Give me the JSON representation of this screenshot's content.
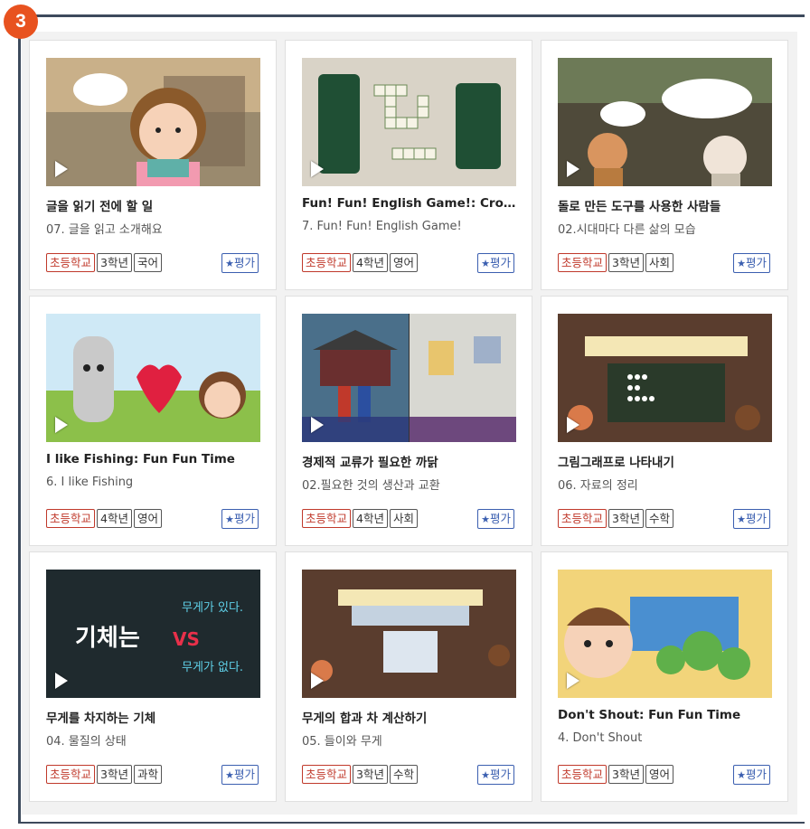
{
  "step_badge": "3",
  "rate_label": "평가",
  "cards": [
    {
      "title": "글을 읽기 전에 할 일",
      "subtitle": "07. 글을 읽고 소개해요",
      "tags": [
        "초등학교",
        "3학년",
        "국어"
      ],
      "theme": "reading"
    },
    {
      "title": "Fun! Fun! English Game!: Cros…",
      "subtitle": "7. Fun! Fun! English Game!",
      "tags": [
        "초등학교",
        "4학년",
        "영어"
      ],
      "theme": "crossword"
    },
    {
      "title": "돌로 만든 도구를 사용한 사람들",
      "subtitle": "02.시대마다 다른 삶의 모습",
      "tags": [
        "초등학교",
        "3학년",
        "사회"
      ],
      "theme": "stone"
    },
    {
      "title": "I like Fishing: Fun Fun Time",
      "subtitle": "6. I like Fishing",
      "tags": [
        "초등학교",
        "4학년",
        "영어"
      ],
      "theme": "fishing"
    },
    {
      "title": "경제적 교류가 필요한 까닭",
      "subtitle": "02.필요한 것의 생산과 교환",
      "tags": [
        "초등학교",
        "4학년",
        "사회"
      ],
      "theme": "economy"
    },
    {
      "title": "그림그래프로 나타내기",
      "subtitle": "06. 자료의 정리",
      "tags": [
        "초등학교",
        "3학년",
        "수학"
      ],
      "theme": "graph"
    },
    {
      "title": "무게를 차지하는 기체",
      "subtitle": "04. 물질의 상태",
      "tags": [
        "초등학교",
        "3학년",
        "과학"
      ],
      "theme": "gas"
    },
    {
      "title": "무게의 합과 차 계산하기",
      "subtitle": "05. 들이와 무게",
      "tags": [
        "초등학교",
        "3학년",
        "수학"
      ],
      "theme": "weight"
    },
    {
      "title": "Don't Shout: Fun Fun Time",
      "subtitle": "4. Don't Shout",
      "tags": [
        "초등학교",
        "3학년",
        "영어"
      ],
      "theme": "shout"
    }
  ],
  "thumb_text": {
    "gas_main": "기체는",
    "gas_vs": "VS",
    "gas_top": "무게가 있다.",
    "gas_bottom": "무게가 없다."
  }
}
